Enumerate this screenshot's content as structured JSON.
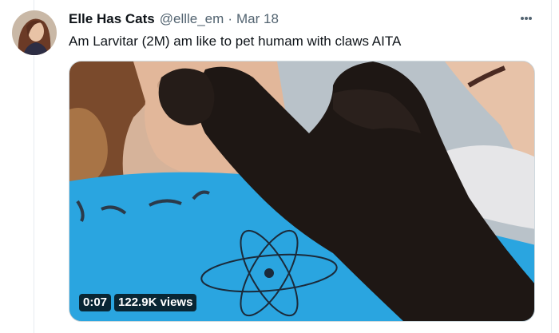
{
  "tweet": {
    "display_name": "Elle Has Cats",
    "handle": "@ellle_em",
    "separator": "·",
    "date": "Mar 18",
    "text": "Am Larvitar (2M) am like to pet humam with claws AITA"
  },
  "media": {
    "duration": "0:07",
    "views": "122.9K views"
  },
  "icons": {
    "more": "more-horizontal-icon",
    "avatar": "avatar-image"
  },
  "colors": {
    "text_primary": "#0f1419",
    "text_secondary": "#536471",
    "shirt_blue": "#2aa5e0",
    "cat_black": "#1e1714"
  }
}
